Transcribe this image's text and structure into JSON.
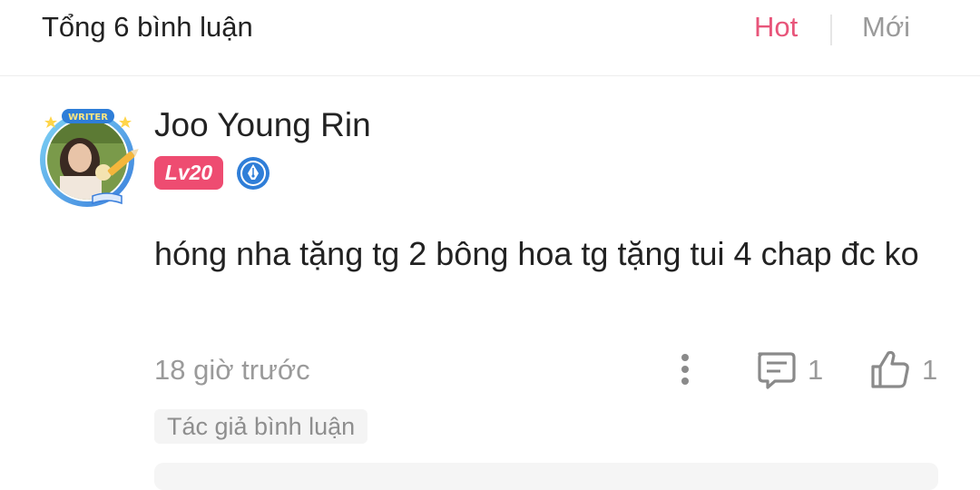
{
  "header": {
    "title": "Tổng 6 bình luận",
    "sort_hot": "Hot",
    "sort_new": "Mới",
    "active_color": "#e8557a"
  },
  "comment": {
    "username": "Joo Young Rin",
    "level": "Lv20",
    "avatar_frame_text": "WRITER",
    "writer_badge_icon": "pen-nib-icon",
    "text": "hóng nha tặng tg 2 bông hoa tg tặng tui 4 chap đc ko",
    "timestamp": "18 giờ trước",
    "reply_count": "1",
    "like_count": "1",
    "author_tag": "Tác giả bình luận"
  }
}
